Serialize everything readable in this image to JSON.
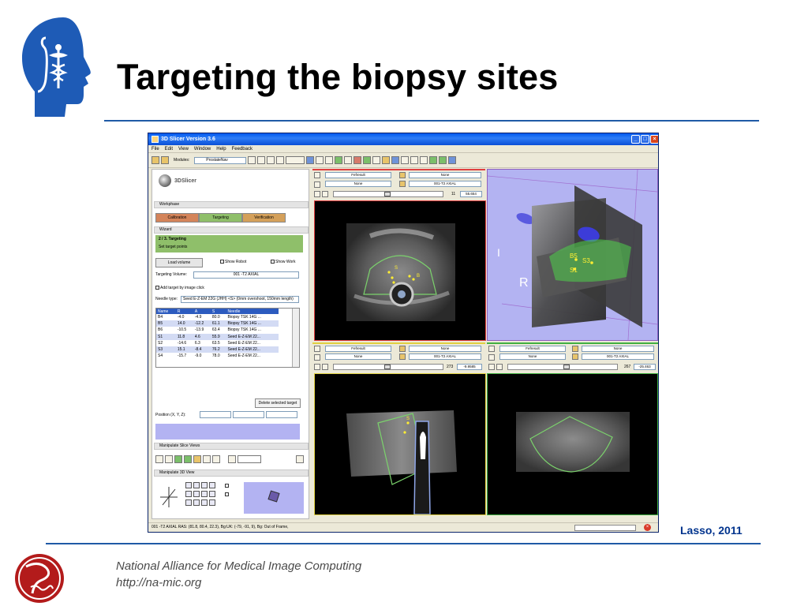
{
  "slide": {
    "title": "Targeting the biopsy sites",
    "credit": "Lasso,  2011",
    "footer_org": "National Alliance for Medical Image Computing",
    "footer_url": "http://na-mic.org"
  },
  "colors": {
    "accent_rule": "#1f5aa6",
    "credit": "#00338d",
    "threed_bg": "#b3b3f2",
    "target_green": "#7bd36c",
    "target_yellow": "#ffee33"
  },
  "window": {
    "title": "3D Slicer Version 3.6",
    "menu": [
      "File",
      "Edit",
      "View",
      "Window",
      "Help",
      "Feedback"
    ],
    "modules_label": "Modules:",
    "module_value": "ProstateNav",
    "status_text": "001 -T2 AXIAL  RAS: (81.8, 80.4, 22.3), Bg:UK: (-79, -91, 9), Bg: Out of Frame,"
  },
  "left_panel": {
    "logo_text": "3DSlicer",
    "workphase_header": "Workphase",
    "workphase_buttons": [
      "Calibration",
      "Targeting",
      "Verification"
    ],
    "wizard_header": "Wizard",
    "wizard_step": "2 / 3. Targeting",
    "wizard_hint": "Set target points",
    "load_volume": "Load volume",
    "show_robot": "Show Robot",
    "show_workspace": "Show Work",
    "targeting_volume_label": "Targeting Volume:",
    "targeting_volume_value": "001 -T2 AXIAL",
    "add_target_label": "Add target by image click",
    "needle_type_label": "Needle type:",
    "needle_type_value": "Seed E-Z-EM 22G (JHH) <S> (0mm overshoot, 150mm length)",
    "table_headers": [
      "Name",
      "R",
      "A",
      "S",
      "Needle"
    ],
    "table_rows": [
      [
        "B4",
        "-4.0",
        "-4.9",
        "80.0",
        "Biopsy TSK 14G ..."
      ],
      [
        "B5",
        "14.0",
        "-12.2",
        "61.1",
        "Biopsy TSK 14G ..."
      ],
      [
        "B6",
        "-10.5",
        "-13.9",
        "63.4",
        "Biopsy TSK 14G ..."
      ],
      [
        "S1",
        "11.8",
        "4.6",
        "55.9",
        "Seed E-Z-EM 22..."
      ],
      [
        "S2",
        "-14.6",
        "6.3",
        "63.5",
        "Seed E-Z-EM 22..."
      ],
      [
        "S3",
        "15.1",
        "-8.4",
        "76.2",
        "Seed E-Z-EM 22..."
      ],
      [
        "S4",
        "-15.7",
        "-9.0",
        "78.0",
        "Seed E-Z-EM 22..."
      ]
    ],
    "delete_target": "Delete selected target",
    "position_label": "Position (X, Y, Z):",
    "manipulate_slice_header": "Manipulate Slice Views",
    "manipulate_3d_header": "Manipulate 3D View"
  },
  "views": {
    "red": {
      "fg": "Fefresult",
      "bg": "None",
      "lb": "None",
      "vol": "001-T2 AXIAL",
      "slice": "11",
      "offset": "55.654"
    },
    "yellow": {
      "fg": "Fefresult",
      "bg": "None",
      "lb": "None",
      "vol": "001-T2 AXIAL",
      "slice": "273",
      "offset": "-9.9585"
    },
    "green": {
      "fg": "Fefresult",
      "bg": "None",
      "lb": "None",
      "vol": "001-T2 AXIAL",
      "slice": "267",
      "offset": "-25.463"
    },
    "threed": {
      "label_i": "I",
      "label_r": "R",
      "labels": [
        "B5",
        "S3",
        "S1"
      ]
    },
    "red_targets": [
      "S",
      "B"
    ],
    "yellow_targets": [
      "S"
    ]
  }
}
